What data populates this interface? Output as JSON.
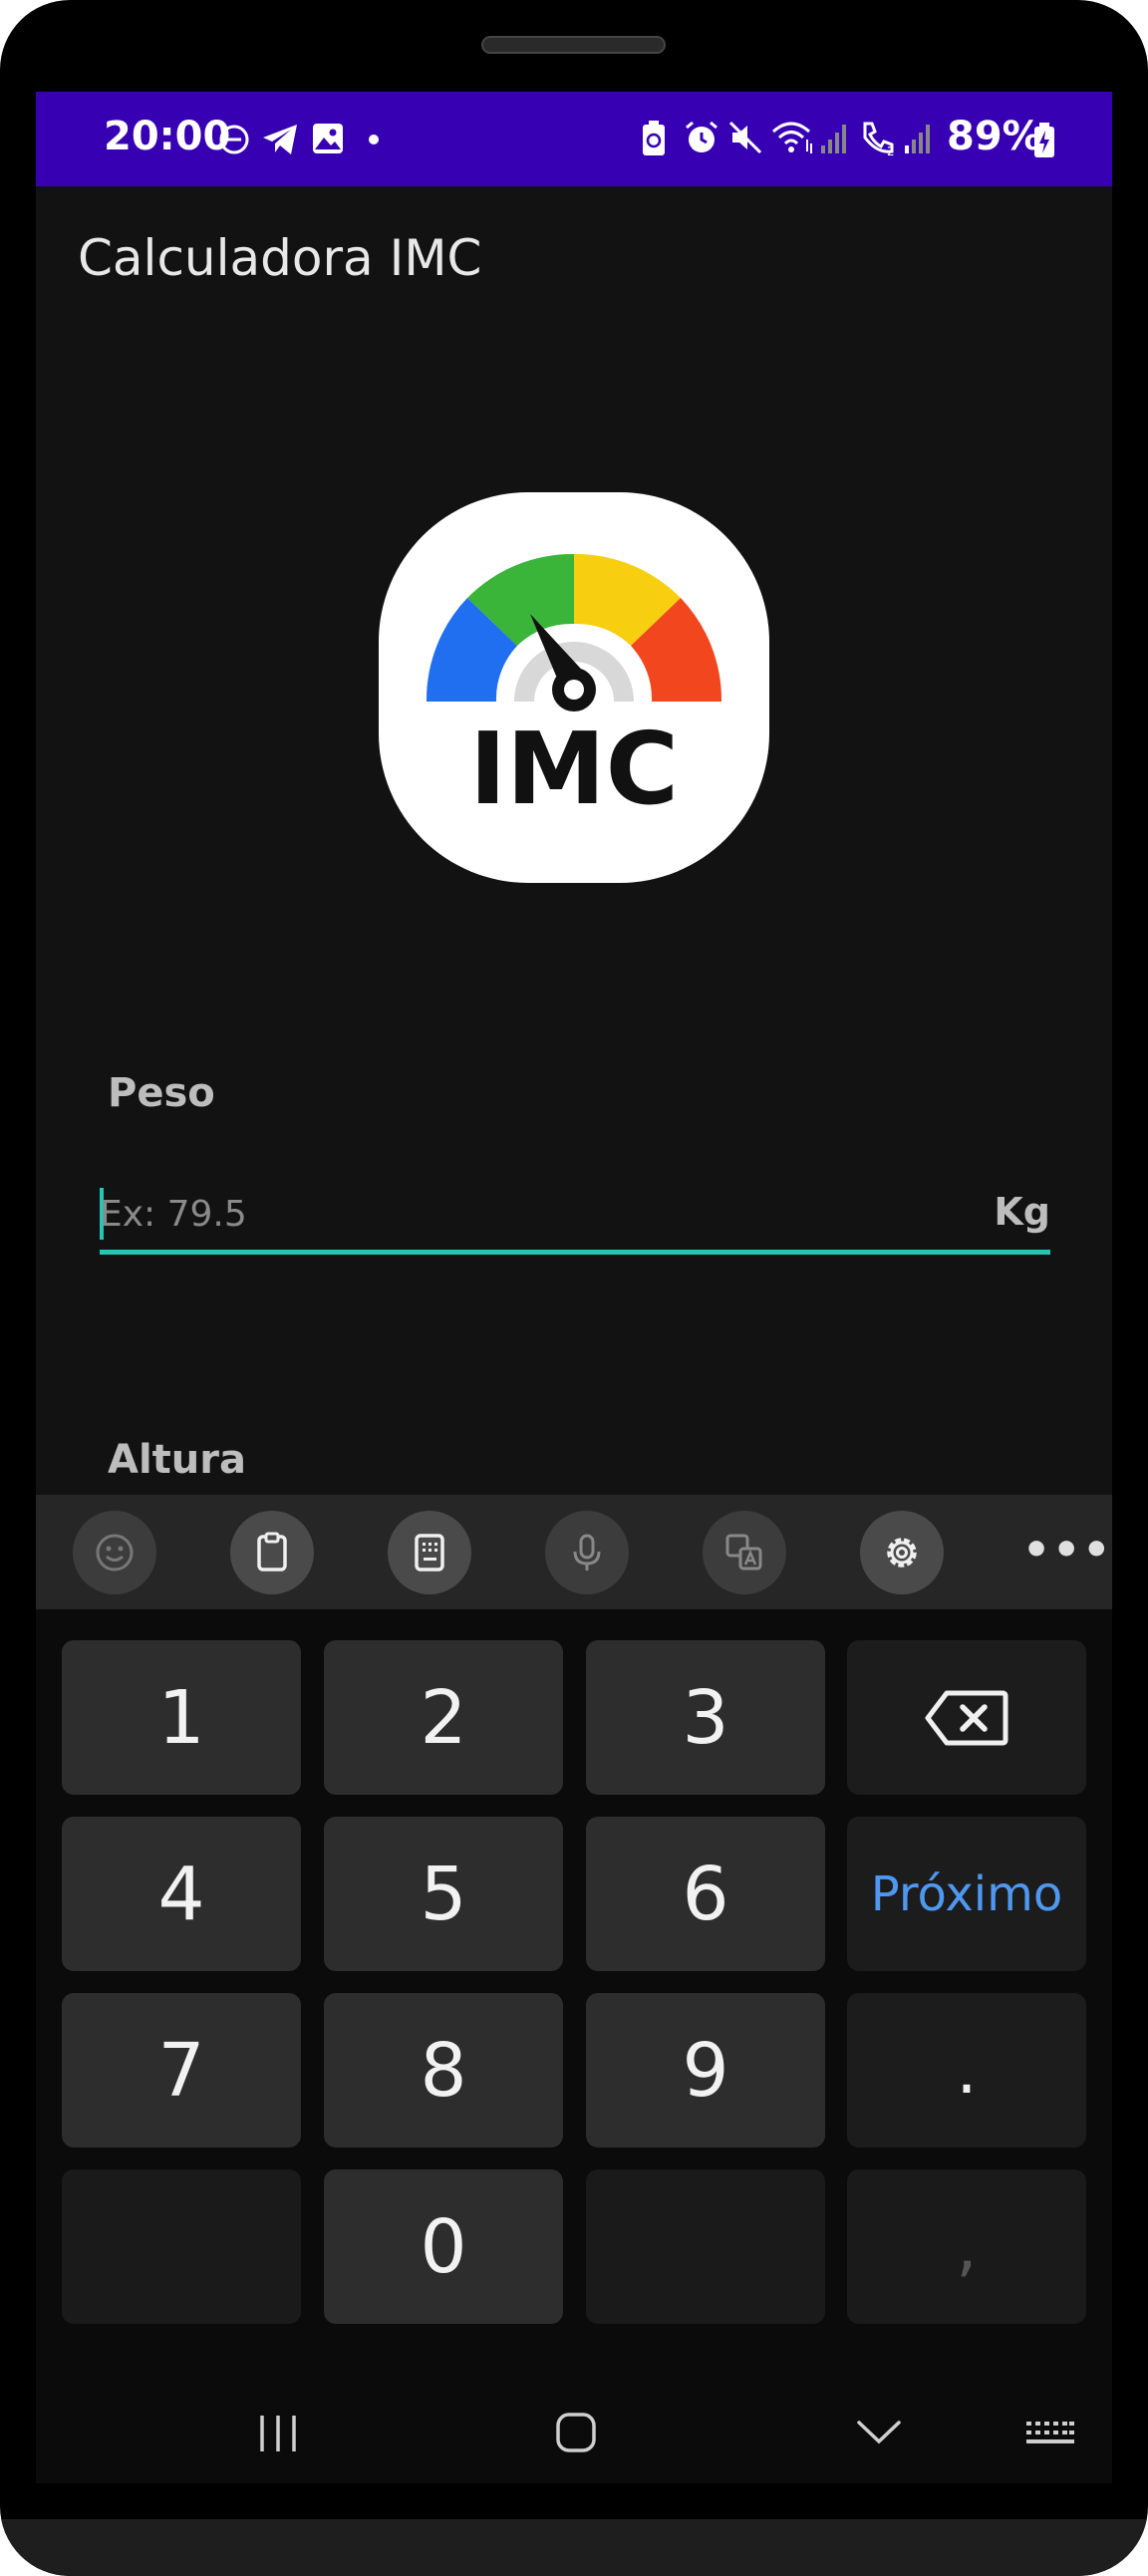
{
  "status_bar": {
    "time": "20:00",
    "battery": "89%",
    "color": "#3700b3"
  },
  "app": {
    "title": "Calculadora IMC",
    "logo_text": "IMC"
  },
  "form": {
    "peso_label": "Peso",
    "peso_placeholder": "Ex: 79.5",
    "peso_suffix": "Kg",
    "altura_label": "Altura",
    "accent": "#26c6b5"
  },
  "keyboard": {
    "toolbar": [
      "emoji-icon",
      "clipboard-icon",
      "keypad-icon",
      "microphone-icon",
      "translate-icon",
      "settings-icon",
      "more-icon"
    ],
    "more_label": "•••",
    "keys": {
      "k1": "1",
      "k2": "2",
      "k3": "3",
      "k4": "4",
      "k5": "5",
      "k6": "6",
      "k7": "7",
      "k8": "8",
      "k9": "9",
      "k0": "0",
      "next": "Próximo",
      "dot": ".",
      "comma": ","
    },
    "next_color": "#4f98ef"
  },
  "navigation": [
    "recent-apps-icon",
    "home-icon",
    "back-icon",
    "keyboard-switch-icon"
  ]
}
